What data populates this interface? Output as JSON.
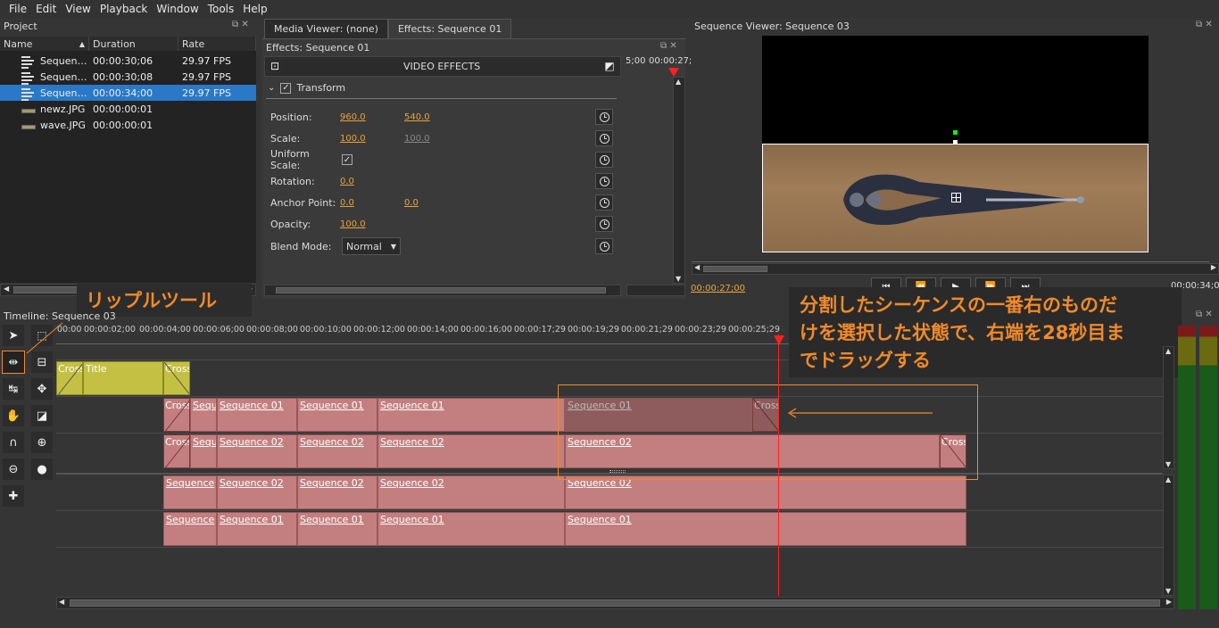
{
  "menu": [
    "File",
    "Edit",
    "View",
    "Playback",
    "Window",
    "Tools",
    "Help"
  ],
  "project": {
    "title": "Project",
    "columns": [
      "Name",
      "Duration",
      "Rate"
    ],
    "rows": [
      {
        "name": "Sequen…",
        "duration": "00:00:30;06",
        "rate": "29.97 FPS",
        "icon": "sequence-icon"
      },
      {
        "name": "Sequen…",
        "duration": "00:00:30;08",
        "rate": "29.97 FPS",
        "icon": "sequence-icon"
      },
      {
        "name": "Sequen…",
        "duration": "00:00:34;00",
        "rate": "29.97 FPS",
        "icon": "sequence-icon"
      },
      {
        "name": "newz.JPG",
        "duration": "00:00:00:01",
        "rate": "",
        "icon": "image-icon"
      },
      {
        "name": "wave.JPG",
        "duration": "00:00:00:01",
        "rate": "",
        "icon": "image-icon"
      }
    ]
  },
  "tabs": [
    "Media Viewer: (none)",
    "Effects: Sequence 01"
  ],
  "effects": {
    "title": "Effects: Sequence 01",
    "header": "VIDEO EFFECTS",
    "section": "Transform",
    "timecode_left": "5;00",
    "timecode_right": "00:00:27;",
    "rows": {
      "position": {
        "label": "Position:",
        "v1": "960.0",
        "v2": "540.0"
      },
      "scale": {
        "label": "Scale:",
        "v1": "100.0",
        "v2": "100.0"
      },
      "uniform": {
        "label": "Uniform Scale:"
      },
      "rotation": {
        "label": "Rotation:",
        "v1": "0.0"
      },
      "anchor": {
        "label": "Anchor Point:",
        "v1": "0.0",
        "v2": "0.0"
      },
      "opacity": {
        "label": "Opacity:",
        "v1": "100.0"
      },
      "blend": {
        "label": "Blend Mode:",
        "value": "Normal"
      }
    }
  },
  "viewer": {
    "title": "Sequence Viewer: Sequence 03",
    "current_time": "00:00:27;00",
    "end_time": "00:00:34;00"
  },
  "timeline": {
    "title": "Timeline: Sequence 03",
    "ruler": [
      "00:00",
      "00:00:02;00",
      "00:00:04;00",
      "00:00:06;00",
      "00:00:08;00",
      "00:00:10;00",
      "00:00:12;00",
      "00:00:14;00",
      "00:00:16;00",
      "00:00:17;29",
      "00:00:19;29",
      "00:00:21;29",
      "00:00:23;29",
      "00:00:25;29"
    ],
    "clips": {
      "cross": "Cross",
      "title": "Title",
      "seq": "Sequence",
      "seq01": "Sequence 01",
      "seq02": "Sequence 02"
    }
  },
  "annotations": {
    "ripple_tool": "リップルツール",
    "instruction": "分割したシーケンスの一番右のものだけを選択した状態で、右端を28秒目までドラッグする",
    "instruction_line1": "分割したシーケンスの一番右のものだ",
    "instruction_line2": "けを選択した状態で、右端を28秒目ま",
    "instruction_line3": "でドラッグする"
  },
  "colors": {
    "accent": "#e8a43a",
    "annotation": "#f08a2a",
    "clip": "#c37f7f",
    "title_clip": "#c4c043",
    "playhead": "#ff2020"
  }
}
